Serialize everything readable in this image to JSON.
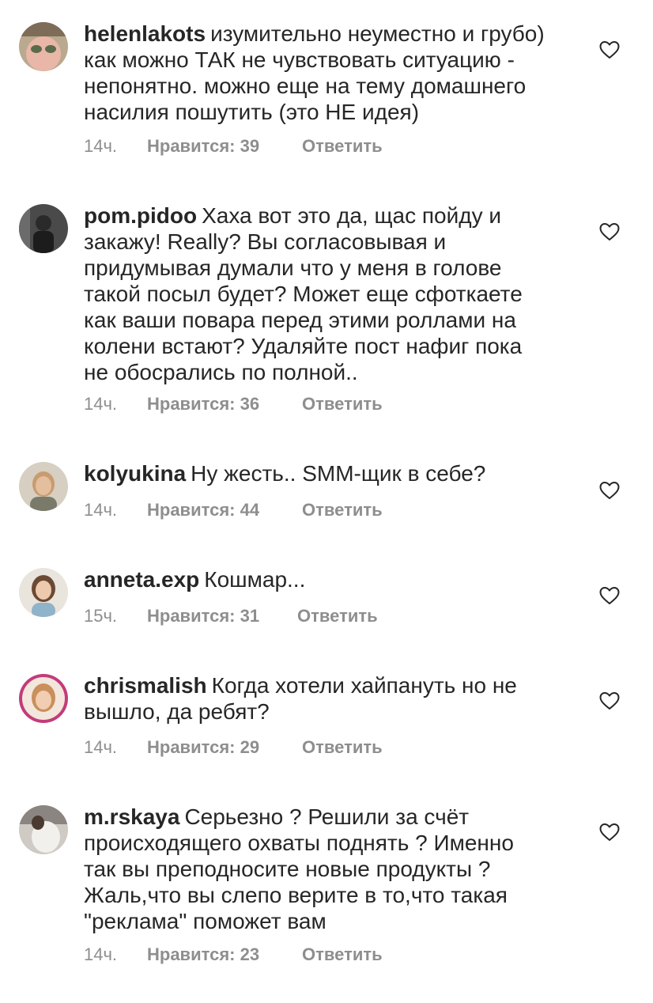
{
  "comments": [
    {
      "username": "helenlakots",
      "text": "изумительно неуместно и грубо)\nкак можно ТАК не чувствовать ситуацию -\nнепонятно. можно еще на тему домашнего\nнасилия пошутить (это НЕ идея)",
      "time": "14ч.",
      "likes": "Нравится: 39",
      "reply": "Ответить"
    },
    {
      "username": "pom.pidoo",
      "text": "Хаха вот это да, щас пойду и\nзакажу! Really? Вы согласовывая и\nпридумывая думали что у меня в голове\nтакой посыл будет? Может еще сфоткаете\nкак ваши повара перед этими роллами на\nколени встают? Удаляйте пост нафиг пока\nне обосрались по полной..",
      "time": "14ч.",
      "likes": "Нравится: 36",
      "reply": "Ответить"
    },
    {
      "username": "kolyukina",
      "text": "Ну жесть.. SMM-щик в себе?",
      "time": "14ч.",
      "likes": "Нравится: 44",
      "reply": "Ответить"
    },
    {
      "username": "anneta.exp",
      "text": "Кошмар...",
      "time": "15ч.",
      "likes": "Нравится: 31",
      "reply": "Ответить"
    },
    {
      "username": "chrismalish",
      "text": "Когда хотели хайпануть но не\nвышло, да ребят?",
      "time": "14ч.",
      "likes": "Нравится: 29",
      "reply": "Ответить"
    },
    {
      "username": "m.rskaya",
      "text": "Серьезно ? Решили за счёт\nпроисходящего охваты поднять ? Именно\nтак вы преподносите новые продукты ?\nЖаль,что вы слепо верите в то,что такая\n\"реклама\" поможет вам",
      "time": "14ч.",
      "likes": "Нравится: 23",
      "reply": "Ответить"
    }
  ],
  "icons": {
    "like": "heart-outline-icon"
  },
  "colors": {
    "text": "#262626",
    "meta": "#8e8e8e"
  }
}
